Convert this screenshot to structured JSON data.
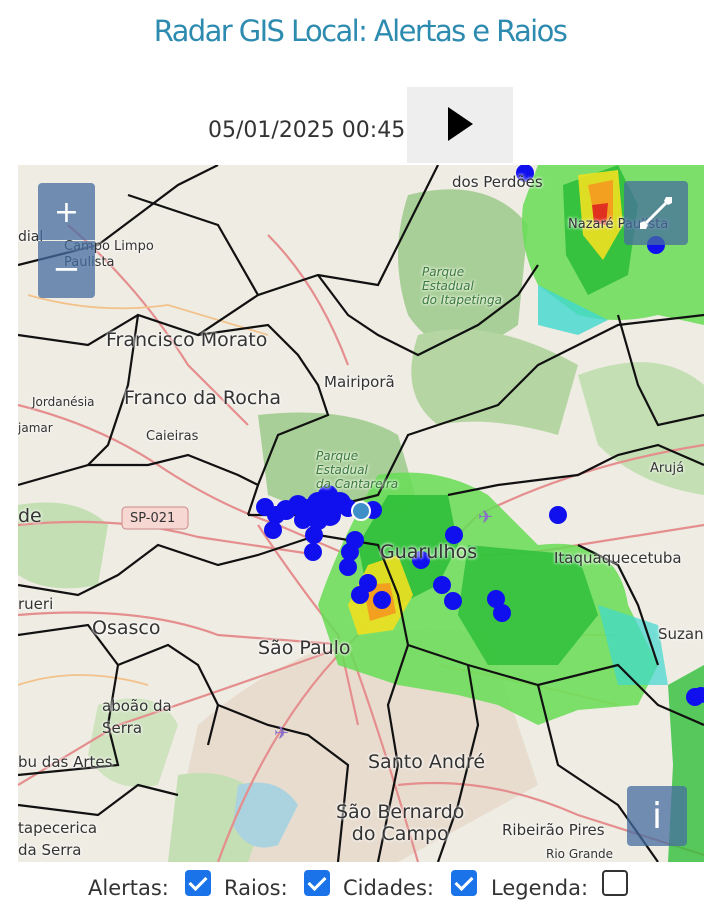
{
  "header": {
    "title": "Radar GIS Local: Alertas e Raios",
    "timestamp": "05/01/2025 00:45",
    "play_icon": "play-icon"
  },
  "map": {
    "zoom_in_label": "+",
    "zoom_out_label": "−",
    "fullscreen_icon": "expand-icon",
    "info_label": "i",
    "place_labels": {
      "campo_limpo_paulista": "Campo Limpo\nPaulista",
      "dos_perdoes": "dos Perdões",
      "nazare_paulista": "Nazaré Paulista",
      "parque_itapetinga": "Parque\nEstadual\ndo Itapetinga",
      "francisco_morato": "Francisco Morato",
      "mairipora": "Mairiporã",
      "jordanesia": "Jordanésia",
      "franco_da_rocha": "Franco da Rocha",
      "jamar": "jamar",
      "caieiras": "Caieiras",
      "parque_cantareira": "Parque\nEstadual\nda Cantareira",
      "aruja": "Arujá",
      "de": "de",
      "sp_021": "SP-021",
      "guarulhos": "Guarulhos",
      "itaquaquecetuba": "Itaquaquecetuba",
      "barueri": "rueri",
      "osasco": "Osasco",
      "sao_paulo": "São Paulo",
      "suzano": "Suzano",
      "taboao_da_serra": "aboão da\nSerra",
      "embu_das_artes": "bu das Artes",
      "santo_andre": "Santo André",
      "sao_bernardo": "São Bernardo\ndo Campo",
      "itapecerica": "tapecerica\nda Serra",
      "ribeirao_pires": "Ribeirão Pires",
      "rio_grande": "Rio Grande",
      "dial": "dial"
    },
    "colors": {
      "lightning": "#1010ee",
      "lightning_recent": "#3f8fc8",
      "radar_light": "#66dd55",
      "radar_mid": "#2fbf3a",
      "radar_yellow": "#f0e020",
      "radar_orange": "#f3a020",
      "radar_red": "#e03020",
      "radar_cyan": "#40d8d0",
      "boundary": "#111111",
      "park": "#a9cf98"
    }
  },
  "layers": {
    "alertas": {
      "label": "Alertas:",
      "checked": true
    },
    "raios": {
      "label": "Raios:",
      "checked": true
    },
    "cidades": {
      "label": "Cidades:",
      "checked": true
    },
    "legenda": {
      "label": "Legenda:",
      "checked": false
    }
  }
}
